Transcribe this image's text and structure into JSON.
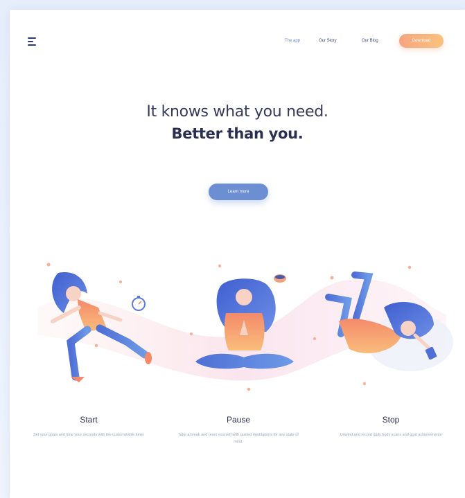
{
  "nav": {
    "links": [
      {
        "label": "The app",
        "active": true
      },
      {
        "label": "Our Story",
        "active": false
      },
      {
        "label": "Our Blog",
        "active": false
      }
    ],
    "download_label": "Download",
    "menu_icon": "hamburger-menu-icon"
  },
  "hero": {
    "line1": "It knows what you need.",
    "line2": "Better than you.",
    "cta_label": "Learn more"
  },
  "features": [
    {
      "title": "Start",
      "text": "Set your goals and time your seconds with the customizable timer"
    },
    {
      "title": "Pause",
      "text": "Take a break and reset yourself with guided meditations for any state of mind."
    },
    {
      "title": "Stop",
      "text": "Unwind and record daily body scans and goal achievements"
    }
  ],
  "colors": {
    "accent": "#6c8fd3",
    "download_gradient_start": "#f7a580",
    "download_gradient_end": "#f9c27c",
    "heading": "#2a2f52",
    "body_text": "#9aa3bf"
  }
}
